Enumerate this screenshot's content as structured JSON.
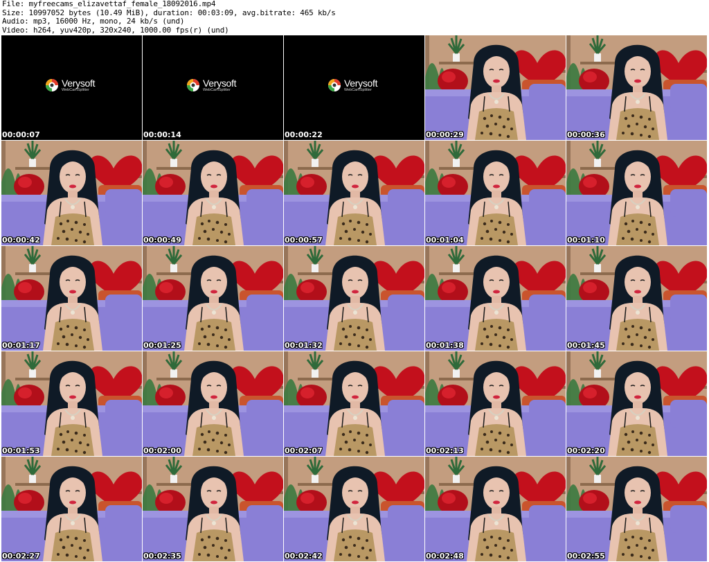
{
  "header": {
    "file": "File: myfreecams_elizavettaf_female_18092016.mp4",
    "size": "Size: 10997052 bytes (10.49 MiB), duration: 00:03:09, avg.bitrate: 465 kb/s",
    "audio": "Audio: mp3, 16000 Hz, mono, 24 kb/s (und)",
    "video": "Video: h264, yuv420p, 320x240, 1000.00 fps(r) (und)"
  },
  "logo": {
    "name": "Verysoft",
    "subtitle": "WebCamSplitter"
  },
  "thumbnails": [
    {
      "time": "00:00:07",
      "kind": "intro"
    },
    {
      "time": "00:00:14",
      "kind": "intro"
    },
    {
      "time": "00:00:22",
      "kind": "intro"
    },
    {
      "time": "00:00:29",
      "kind": "frame"
    },
    {
      "time": "00:00:36",
      "kind": "frame"
    },
    {
      "time": "00:00:42",
      "kind": "frame"
    },
    {
      "time": "00:00:49",
      "kind": "frame"
    },
    {
      "time": "00:00:57",
      "kind": "frame"
    },
    {
      "time": "00:01:04",
      "kind": "frame"
    },
    {
      "time": "00:01:10",
      "kind": "frame"
    },
    {
      "time": "00:01:17",
      "kind": "frame"
    },
    {
      "time": "00:01:25",
      "kind": "frame"
    },
    {
      "time": "00:01:32",
      "kind": "frame"
    },
    {
      "time": "00:01:38",
      "kind": "frame"
    },
    {
      "time": "00:01:45",
      "kind": "frame"
    },
    {
      "time": "00:01:53",
      "kind": "frame"
    },
    {
      "time": "00:02:00",
      "kind": "frame"
    },
    {
      "time": "00:02:07",
      "kind": "frame"
    },
    {
      "time": "00:02:13",
      "kind": "frame"
    },
    {
      "time": "00:02:20",
      "kind": "frame"
    },
    {
      "time": "00:02:27",
      "kind": "frame"
    },
    {
      "time": "00:02:35",
      "kind": "frame"
    },
    {
      "time": "00:02:42",
      "kind": "frame"
    },
    {
      "time": "00:02:48",
      "kind": "frame"
    },
    {
      "time": "00:02:55",
      "kind": "frame"
    }
  ],
  "colors": {
    "wall": "#caa487",
    "sofa": "#8a7fd6",
    "heart": "#c3101c",
    "hair": "#0f1a26",
    "skin": "#e8c3b0",
    "plant": "#2f6a3a"
  }
}
